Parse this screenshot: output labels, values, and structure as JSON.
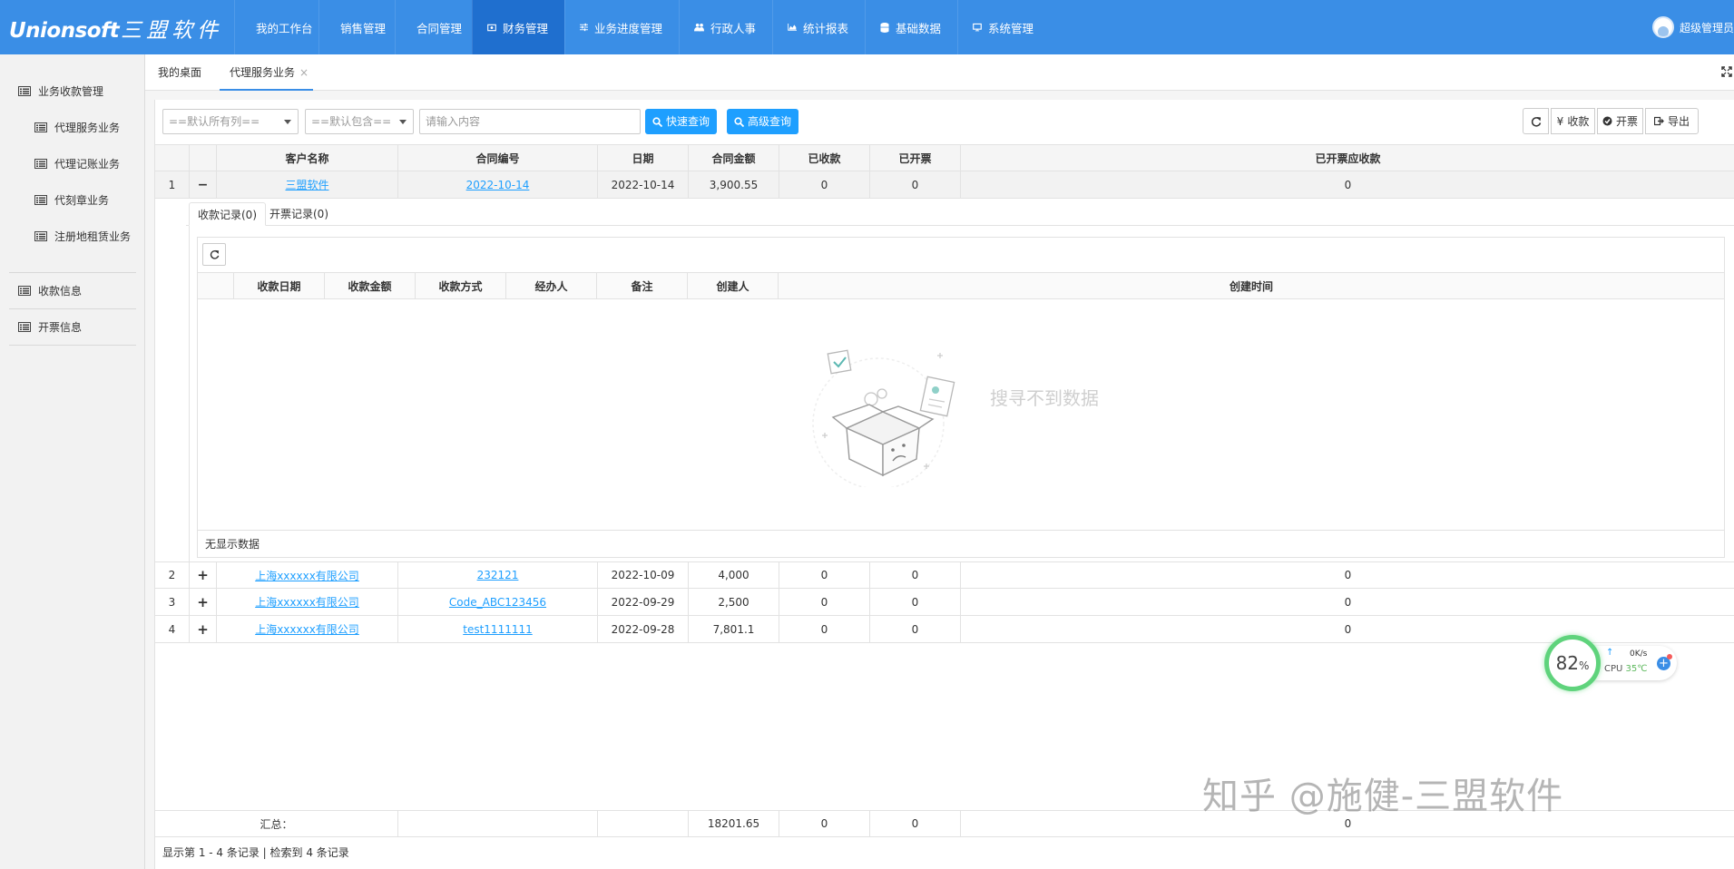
{
  "brand": {
    "logo_latin": "Unionsoft",
    "logo_cn": "三盟软件"
  },
  "nav": [
    {
      "label": "我的工作台",
      "icon": "monitor-icon"
    },
    {
      "label": "销售管理",
      "icon": "line-chart-icon"
    },
    {
      "label": "合同管理",
      "icon": "grid-icon"
    },
    {
      "label": "财务管理",
      "icon": "money-icon",
      "active": true
    },
    {
      "label": "业务进度管理",
      "icon": "sliders-icon"
    },
    {
      "label": "行政人事",
      "icon": "users-icon"
    },
    {
      "label": "统计报表",
      "icon": "area-chart-icon"
    },
    {
      "label": "基础数据",
      "icon": "database-icon"
    },
    {
      "label": "系统管理",
      "icon": "desktop-icon"
    }
  ],
  "user": {
    "name": "超级管理员"
  },
  "tabs": [
    {
      "label": "我的桌面"
    },
    {
      "label": "代理服务业务",
      "active": true,
      "close": "×"
    }
  ],
  "sidebar": {
    "groups": [
      {
        "label": "业务收款管理",
        "children": [
          "代理服务业务",
          "代理记账业务",
          "代刻章业务",
          "注册地租赁业务"
        ]
      },
      {
        "label": "收款信息",
        "children": []
      },
      {
        "label": "开票信息",
        "children": []
      }
    ]
  },
  "toolbar": {
    "select1": "==默认所有列==",
    "select2": "==默认包含==",
    "search_placeholder": "请输入内容",
    "quick_search": "快速查询",
    "advanced_search": "高级查询",
    "receive": "收款",
    "invoice": "开票",
    "export": "导出",
    "yen_symbol": "¥"
  },
  "table": {
    "columns": [
      "客户名称",
      "合同编号",
      "日期",
      "合同金额",
      "已收款",
      "已开票",
      "已开票应收款"
    ],
    "rows": [
      {
        "index": "1",
        "toggle": "−",
        "customer": "三盟软件",
        "contract": "2022-10-14",
        "date": "2022-10-14",
        "amount": "3,900.55",
        "received": "0",
        "invoiced": "0",
        "receivable": "0"
      },
      {
        "index": "2",
        "toggle": "+",
        "customer": "上海xxxxxx有限公司",
        "contract": "232121",
        "date": "2022-10-09",
        "amount": "4,000",
        "received": "0",
        "invoiced": "0",
        "receivable": "0"
      },
      {
        "index": "3",
        "toggle": "+",
        "customer": "上海xxxxxx有限公司",
        "contract": "Code_ABC123456",
        "date": "2022-09-29",
        "amount": "2,500",
        "received": "0",
        "invoiced": "0",
        "receivable": "0"
      },
      {
        "index": "4",
        "toggle": "+",
        "customer": "上海xxxxxx有限公司",
        "contract": "test1111111",
        "date": "2022-09-28",
        "amount": "7,801.1",
        "received": "0",
        "invoiced": "0",
        "receivable": "0"
      }
    ],
    "summary": {
      "label": "汇总：",
      "amount": "18201.65",
      "received": "0",
      "invoiced": "0",
      "receivable": "0"
    },
    "footer": "显示第 1 - 4 条记录 | 检索到 4 条记录"
  },
  "detail": {
    "tabs": [
      "收款记录(0)",
      "开票记录(0)"
    ],
    "columns": [
      "收款日期",
      "收款金额",
      "收款方式",
      "经办人",
      "备注",
      "创建人",
      "创建时间"
    ],
    "empty_text": "搜寻不到数据",
    "footer": "无显示数据"
  },
  "watermark": "知乎 @施健-三盟软件",
  "cpu_widget": {
    "percent": "82",
    "percent_sign": "%",
    "arrow": "↑",
    "speed": "0K/s",
    "label": "CPU",
    "temp": "35℃",
    "plus": "+"
  },
  "colors": {
    "header_bg": "#3a8ee6",
    "nav_active": "#1f6fcf",
    "button_blue": "#1e9fff"
  }
}
